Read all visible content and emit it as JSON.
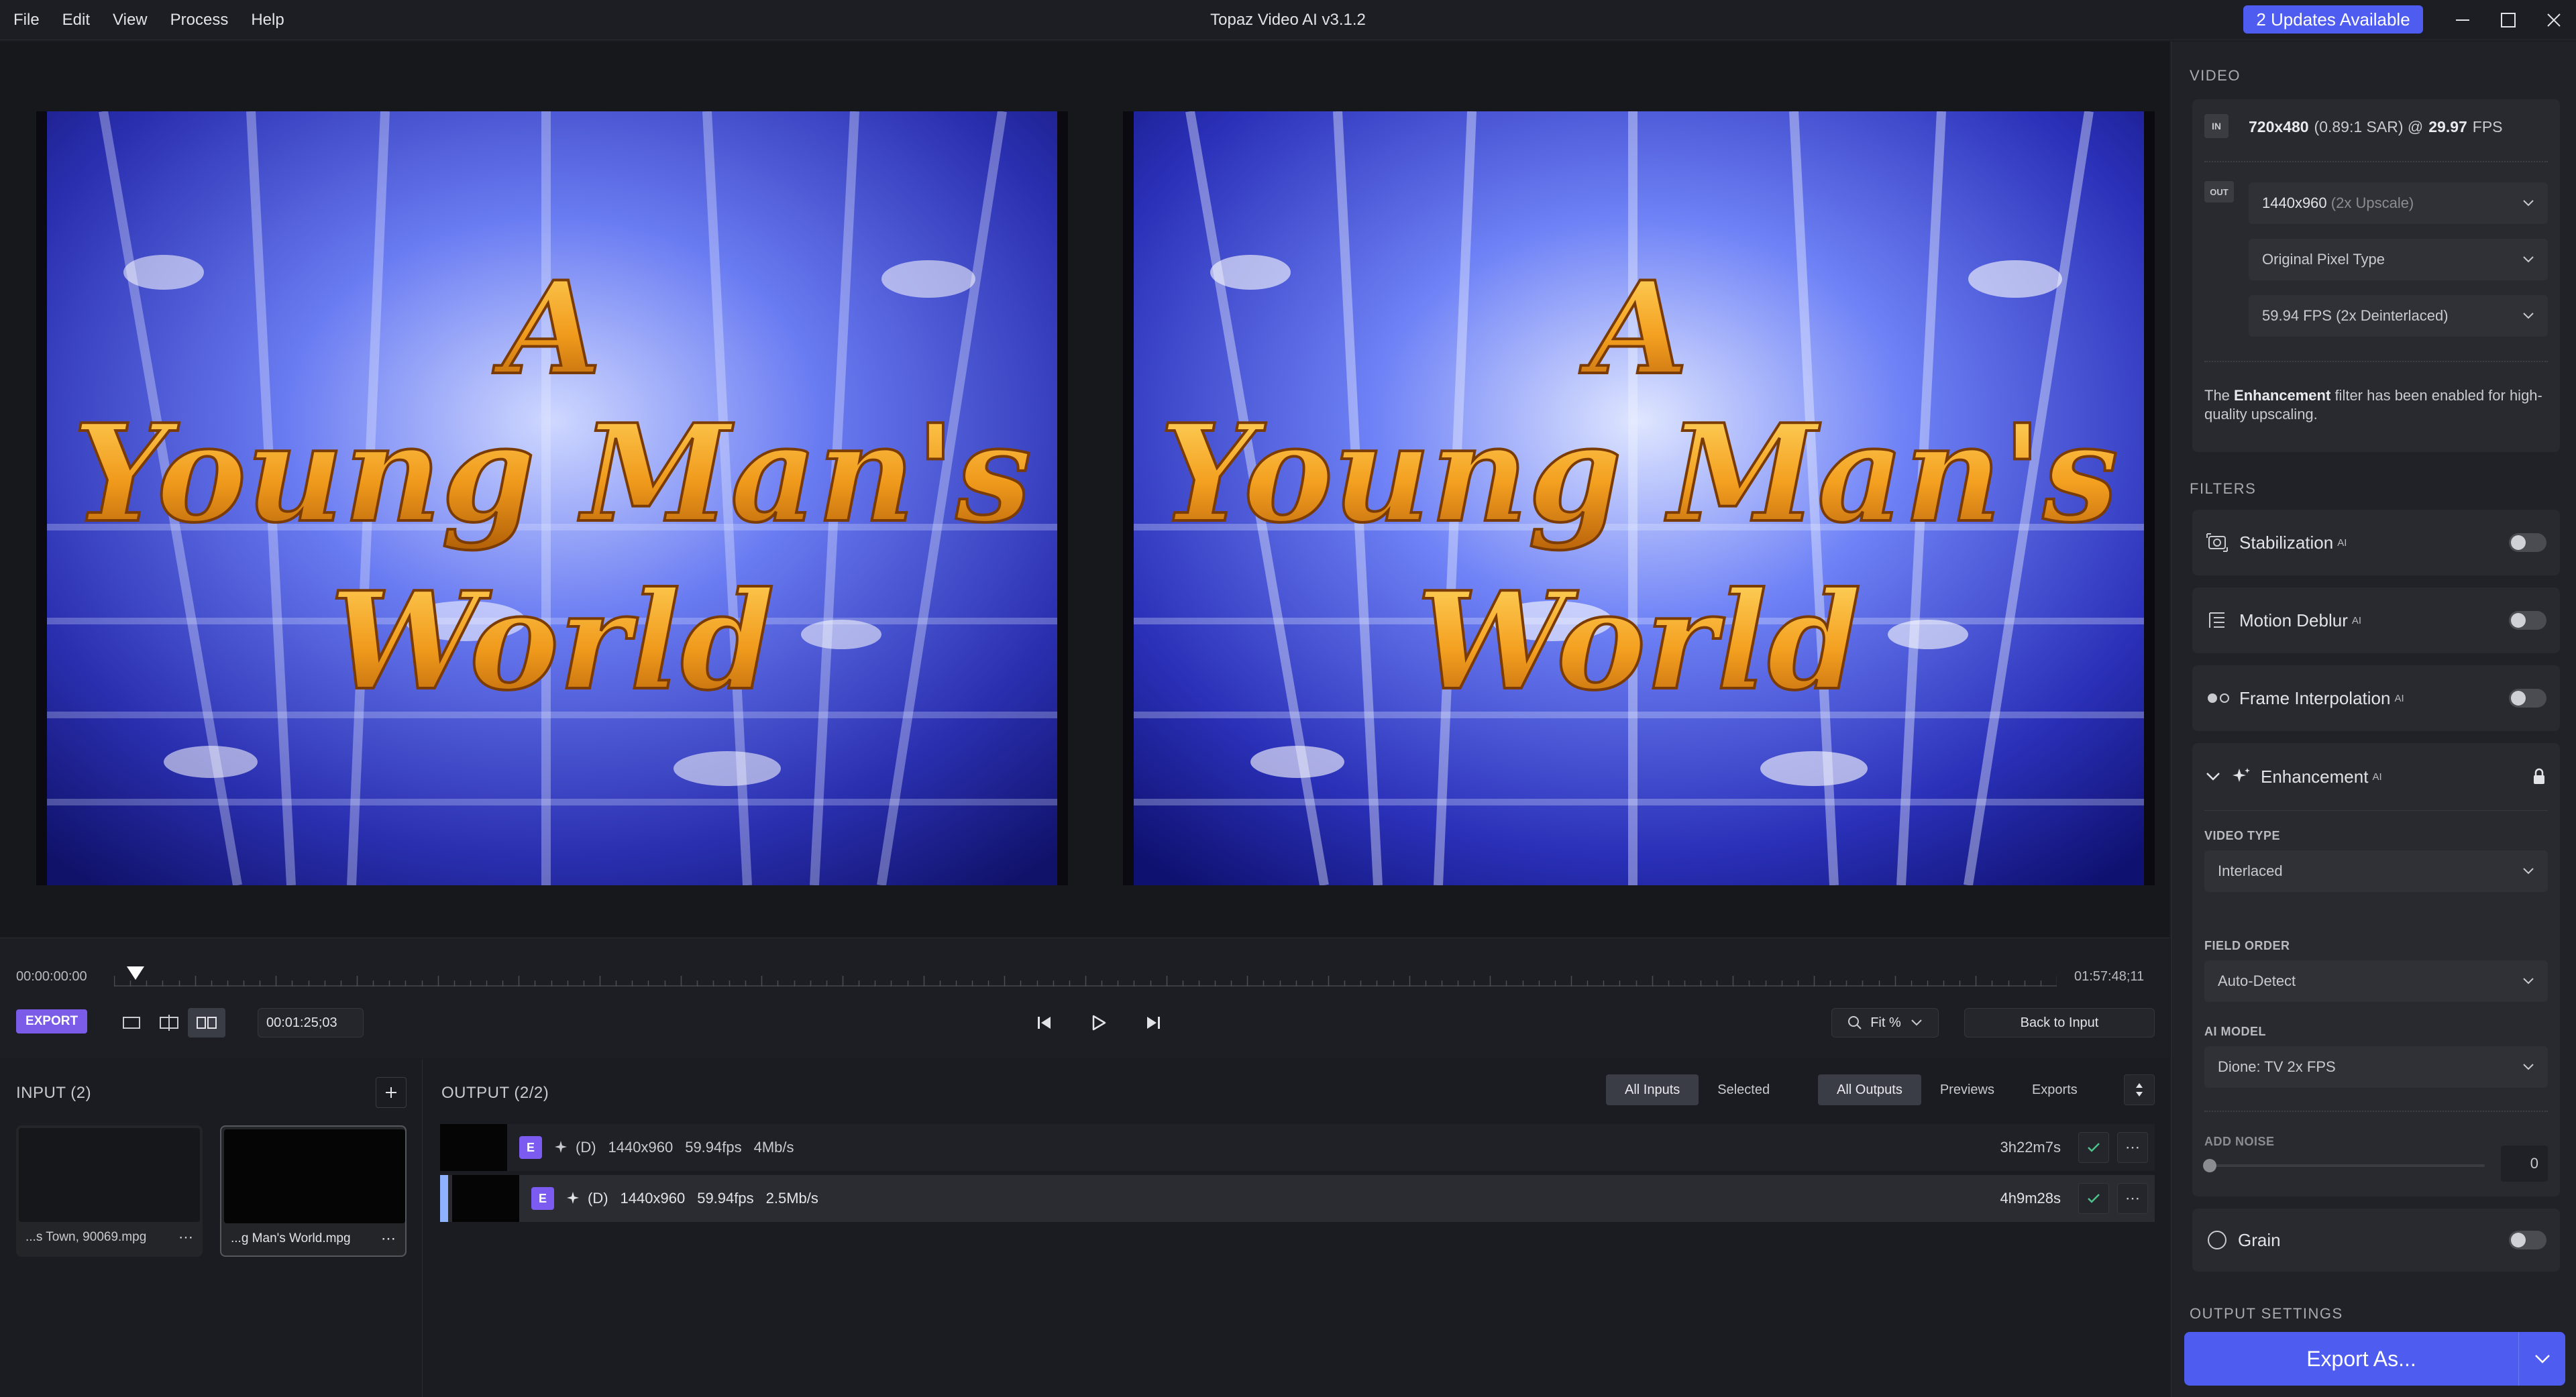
{
  "menu": [
    "File",
    "Edit",
    "View",
    "Process",
    "Help"
  ],
  "app_title": "Topaz Video AI  v3.1.2",
  "updates_label": "2 Updates Available",
  "preview": {
    "title_line1": "A",
    "title_line2": "Young Man's",
    "title_line3": "World"
  },
  "timeline": {
    "start_time": "00:00:00:00",
    "end_time": "01:57:48;11",
    "playhead_fraction": 0.011,
    "export_label": "EXPORT",
    "current_time": "00:01:25;03",
    "zoom_label": "Fit %",
    "back_to_input": "Back to Input"
  },
  "input_panel": {
    "title": "INPUT (2)",
    "items": [
      {
        "name": "...s Town, 90069.mpg"
      },
      {
        "name": "...g Man's World.mpg"
      }
    ]
  },
  "output_panel": {
    "title": "OUTPUT (2/2)",
    "filter_tabs": [
      "All Inputs",
      "Selected"
    ],
    "view_tabs": [
      "All Outputs",
      "Previews",
      "Exports"
    ],
    "rows": [
      {
        "badge": "E",
        "model": "(D)",
        "res": "1440x960",
        "fps": "59.94fps",
        "bitrate": "4Mb/s",
        "time": "3h22m7s"
      },
      {
        "badge": "E",
        "model": "(D)",
        "res": "1440x960",
        "fps": "59.94fps",
        "bitrate": "2.5Mb/s",
        "time": "4h9m28s"
      }
    ]
  },
  "right_panel": {
    "video_label": "VIDEO",
    "in_tag": "IN",
    "in_res": "720x480",
    "in_sar": "(0.89:1 SAR) @",
    "in_fps": "29.97",
    "in_fps_unit": "FPS",
    "out_tag": "OUT",
    "out_resolution_value": "1440x960",
    "out_resolution_note": "(2x Upscale)",
    "out_pixel": "Original Pixel Type",
    "out_fps": "59.94 FPS (2x Deinterlaced)",
    "note_prefix": "The",
    "note_bold": "Enhancement",
    "note_rest": "filter has been enabled for high-quality upscaling.",
    "filters_label": "FILTERS",
    "ai_tag": "AI",
    "filters": {
      "stabilization": "Stabilization",
      "motion_deblur": "Motion Deblur",
      "frame_interpolation": "Frame Interpolation",
      "enhancement": "Enhancement",
      "grain": "Grain"
    },
    "video_type_label": "VIDEO TYPE",
    "video_type_value": "Interlaced",
    "field_order_label": "FIELD ORDER",
    "field_order_value": "Auto-Detect",
    "ai_model_label": "AI MODEL",
    "ai_model_value": "Dione: TV 2x FPS",
    "add_noise_label": "ADD NOISE",
    "add_noise_value": "0",
    "output_settings_label": "OUTPUT SETTINGS",
    "export_as": "Export As..."
  },
  "colors": {
    "accent": "#4e5cf0",
    "badge": "#7c5cf0",
    "export_badge": "#7b5ce8",
    "title_gold": "#f0a21e"
  }
}
